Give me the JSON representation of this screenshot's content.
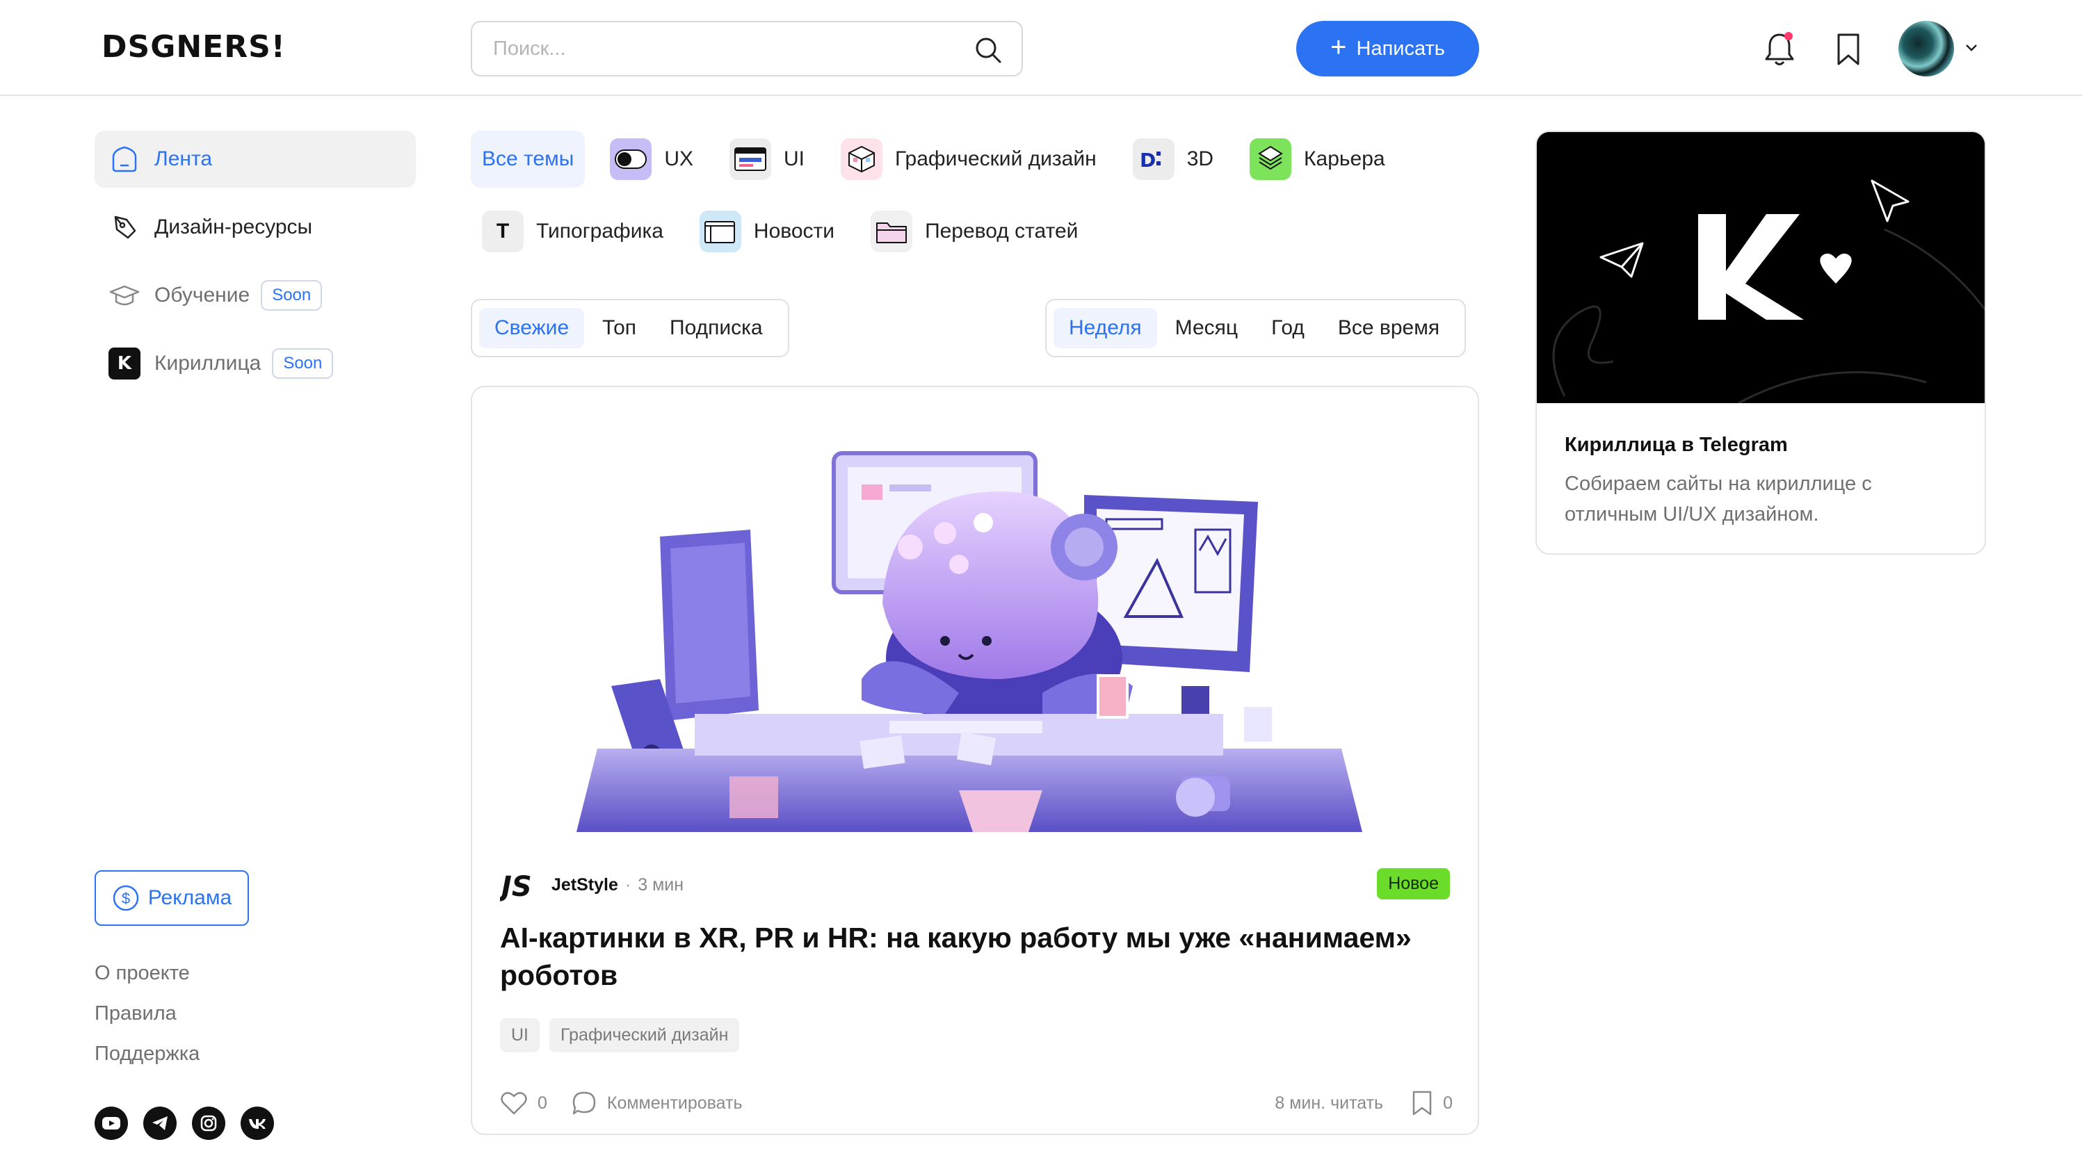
{
  "header": {
    "logo": "DSGNERS!",
    "search_placeholder": "Поиск...",
    "write_label": "Написать"
  },
  "sidebar": {
    "items": [
      {
        "label": "Лента",
        "icon": "home-icon",
        "active": true
      },
      {
        "label": "Дизайн-ресурсы",
        "icon": "pen-tool-icon"
      },
      {
        "label": "Обучение",
        "icon": "graduation-cap-icon",
        "badge": "Soon"
      },
      {
        "label": "Кириллица",
        "icon": "kirillitsa-logo",
        "badge": "Soon"
      }
    ],
    "ad_label": "Реклама",
    "footer_links": [
      "О проекте",
      "Правила",
      "Поддержка"
    ],
    "socials": [
      "youtube-icon",
      "telegram-icon",
      "instagram-icon",
      "vk-icon"
    ]
  },
  "topics": {
    "row1": [
      {
        "label": "Все темы",
        "active": true
      },
      {
        "label": "UX",
        "icon": "toggle-icon"
      },
      {
        "label": "UI",
        "icon": "window-icon"
      },
      {
        "label": "Графический дизайн",
        "icon": "cube-icon"
      },
      {
        "label": "3D",
        "icon": "3d-icon"
      },
      {
        "label": "Карьера",
        "icon": "stack-icon"
      }
    ],
    "row2": [
      {
        "label": "Типографика",
        "icon": "type-icon",
        "glyph": "T"
      },
      {
        "label": "Новости",
        "icon": "news-icon"
      },
      {
        "label": "Перевод статей",
        "icon": "folder-icon"
      }
    ]
  },
  "feed_tabs": [
    "Свежие",
    "Топ",
    "Подписка"
  ],
  "period_tabs": [
    "Неделя",
    "Месяц",
    "Год",
    "Все время"
  ],
  "post": {
    "author": "JetStyle",
    "time": "3 мин",
    "badge": "Новое",
    "title": "AI-картинки в XR, PR и HR: на какую работу мы уже «нанимаем» роботов",
    "tags": [
      "UI",
      "Графический дизайн"
    ],
    "likes": "0",
    "comment_label": "Комментировать",
    "read_time": "8 мин. читать",
    "bookmarks": "0"
  },
  "promo": {
    "title": "Кириллица в Telegram",
    "text": "Собираем сайты на кириллице с отличным UI/UX дизайном."
  },
  "colors": {
    "accent": "#2b73f2",
    "new_badge": "#6bdc2a"
  }
}
